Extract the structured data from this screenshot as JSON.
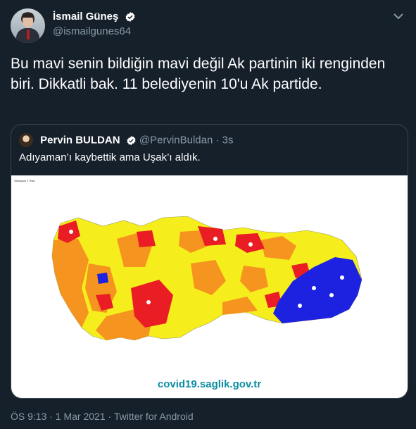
{
  "tweet": {
    "display_name": "İsmail Güneş",
    "handle": "@ismailgunes64",
    "text": "Bu mavi senin bildiğin mavi değil Ak partinin iki renginden biri. Dikkatli bak. 11 belediyenin 10'u Ak partide.",
    "footer": "ÖS 9:13 · 1 Mar 2021 · Twitter for Android"
  },
  "quote": {
    "display_name": "Pervin BULDAN",
    "handle": "@PervinBuldan",
    "separator": "·",
    "time": "3s",
    "text": "Adıyaman’ı kaybettik ama Uşak’ı aldık.",
    "image": {
      "caption": "Vaysayon 1 Risk",
      "url_text": "covid19.saglik.gov.tr"
    }
  },
  "colors": {
    "background": "#15202b",
    "secondary_text": "#8899a6",
    "border": "#38444d",
    "verified_badge": "#ffffff",
    "risk_yellow": "#f5ee1c",
    "risk_orange": "#f5941e",
    "risk_red": "#ea1d24",
    "risk_blue": "#1d22e0"
  },
  "icons": {
    "verified": "verified-badge-icon",
    "more": "chevron-down-icon"
  }
}
